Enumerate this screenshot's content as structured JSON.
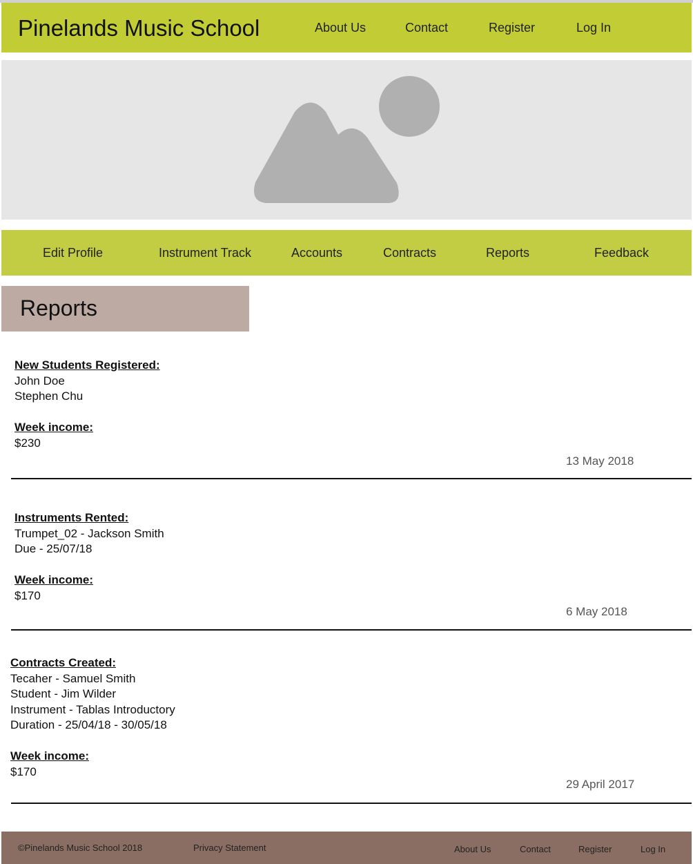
{
  "header": {
    "title": "Pinelands Music School",
    "nav": [
      "About Us",
      "Contact",
      "Register",
      "Log In"
    ]
  },
  "hero": {
    "icon": "image-placeholder-icon"
  },
  "subnav": [
    "Edit Profile",
    "Instrument Track",
    "Accounts",
    "Contracts",
    "Reports",
    "Feedback"
  ],
  "page_heading": "Reports",
  "reports": [
    {
      "label": "New Students Registered:",
      "lines": [
        "John Doe",
        "Stephen Chu"
      ],
      "income_label": "Week income:",
      "income": "$230",
      "date": "13 May 2018"
    },
    {
      "label": "Instruments Rented:",
      "lines": [
        "Trumpet_02 - Jackson Smith",
        "Due - 25/07/18"
      ],
      "income_label": "Week income:",
      "income": "$170",
      "date": "6 May 2018"
    },
    {
      "label": "Contracts Created:",
      "lines": [
        "Tecaher - Samuel Smith",
        "Student - Jim Wilder",
        "Instrument - Tablas Introductory",
        "Duration - 25/04/18 - 30/05/18"
      ],
      "income_label": "Week income:",
      "income": "$170",
      "date": "29 April 2017"
    }
  ],
  "footer": {
    "copyright": "©Pinelands Music School 2018",
    "privacy": "Privacy Statement",
    "nav": [
      "About Us",
      "Contact",
      "Register",
      "Log In"
    ]
  },
  "colors": {
    "header_bg": "#c2cd36",
    "subnav_bg": "#c2cd44",
    "heading_bg": "#bcaaa3",
    "footer_bg": "#8b6e63",
    "hero_bg": "#e6e6e6",
    "placeholder_gray": "#b0b0b0"
  }
}
